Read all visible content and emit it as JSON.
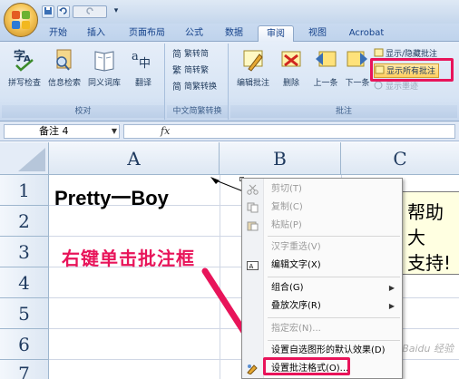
{
  "titlebar": {
    "qat_items": [
      "▾"
    ]
  },
  "tabs": [
    {
      "label": "开始"
    },
    {
      "label": "插入"
    },
    {
      "label": "页面布局"
    },
    {
      "label": "公式"
    },
    {
      "label": "数据"
    },
    {
      "label": "审阅"
    },
    {
      "label": "视图"
    },
    {
      "label": "Acrobat"
    }
  ],
  "ribbon": {
    "proofing": {
      "label": "校对",
      "buttons": [
        "拼写检查",
        "信息检索",
        "同义词库",
        "翻译"
      ]
    },
    "chinese": {
      "label": "中文简繁转换",
      "buttons": [
        "繁转简",
        "简转繁",
        "简繁转换"
      ]
    },
    "comments": {
      "label": "批注",
      "buttons": [
        "编辑批注",
        "删除",
        "上一条",
        "下一条"
      ],
      "side_buttons": [
        "显示/隐藏批注",
        "显示所有批注",
        "显示墨迹"
      ]
    }
  },
  "formula_bar": {
    "name_box": "备注 4",
    "fx": "fx"
  },
  "grid": {
    "columns": [
      "A",
      "B",
      "C"
    ],
    "rows": [
      "1",
      "2",
      "3",
      "4",
      "5",
      "6",
      "7"
    ],
    "cell_a1": "Pretty一Boy",
    "comment_lines": [
      "帮助大",
      "支持!"
    ]
  },
  "annotation": "右键单击批注框",
  "context_menu": {
    "items": [
      {
        "label": "剪切(T)",
        "disabled": true
      },
      {
        "label": "复制(C)",
        "disabled": true
      },
      {
        "label": "粘贴(P)",
        "disabled": true
      },
      {
        "label": "汉字重选(V)",
        "disabled": true
      },
      {
        "label": "编辑文字(X)",
        "disabled": false
      },
      {
        "label": "组合(G)",
        "disabled": false,
        "submenu": true
      },
      {
        "label": "叠放次序(R)",
        "disabled": false,
        "submenu": true
      },
      {
        "label": "指定宏(N)...",
        "disabled": true
      },
      {
        "label": "设置自选图形的默认效果(D)",
        "disabled": false
      },
      {
        "label": "设置批注格式(O)...",
        "disabled": false
      }
    ]
  },
  "watermark": "Baidu 经验",
  "colors": {
    "highlight": "#e8145a",
    "comment_bg": "#ffffe1",
    "ribbon_bg": "#d7e4f4"
  }
}
